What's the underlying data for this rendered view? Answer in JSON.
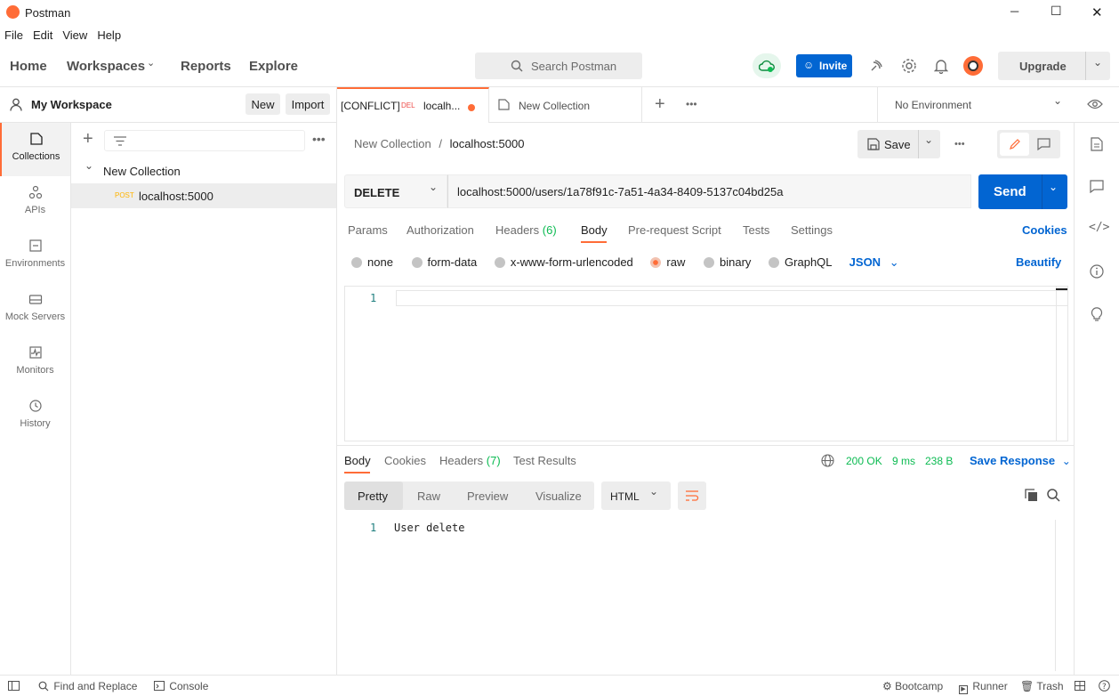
{
  "window": {
    "title": "Postman",
    "minimize": "─",
    "maximize": "☐",
    "close": "✕"
  },
  "menu": [
    "File",
    "Edit",
    "View",
    "Help"
  ],
  "header": {
    "home": "Home",
    "workspaces": "Workspaces",
    "reports": "Reports",
    "explore": "Explore",
    "search_placeholder": "Search Postman",
    "invite": "Invite",
    "upgrade": "Upgrade"
  },
  "sidebar": {
    "workspace_name": "My Workspace",
    "new_label": "New",
    "import_label": "Import",
    "rail": [
      {
        "label": "Collections",
        "icon": "collections-icon"
      },
      {
        "label": "APIs",
        "icon": "apis-icon"
      },
      {
        "label": "Environments",
        "icon": "environments-icon"
      },
      {
        "label": "Mock Servers",
        "icon": "mock-servers-icon"
      },
      {
        "label": "Monitors",
        "icon": "monitors-icon"
      },
      {
        "label": "History",
        "icon": "history-icon"
      }
    ],
    "collection_name": "New Collection",
    "request": {
      "method": "POST",
      "name": "localhost:5000"
    }
  },
  "tabs": [
    {
      "prefix": "[CONFLICT]",
      "method": "DEL",
      "name": "localh..."
    },
    {
      "name": "New Collection"
    }
  ],
  "environment": "No Environment",
  "breadcrumb": {
    "collection": "New Collection",
    "sep": "/",
    "request": "localhost:5000"
  },
  "save_label": "Save",
  "request": {
    "method": "DELETE",
    "url": "localhost:5000/users/1a78f91c-7a51-4a34-8409-5137c04bd25a",
    "send_label": "Send",
    "tabs": {
      "params": "Params",
      "auth": "Authorization",
      "headers": "Headers",
      "headers_count": "(6)",
      "body": "Body",
      "prereq": "Pre-request Script",
      "tests": "Tests",
      "settings": "Settings",
      "cookies": "Cookies"
    },
    "body_modes": {
      "none": "none",
      "form_data": "form-data",
      "urlencoded": "x-www-form-urlencoded",
      "raw": "raw",
      "binary": "binary",
      "graphql": "GraphQL",
      "format": "JSON",
      "beautify": "Beautify"
    },
    "editor_line": "1"
  },
  "response": {
    "tabs": {
      "body": "Body",
      "cookies": "Cookies",
      "headers": "Headers",
      "headers_count": "(7)",
      "tests": "Test Results"
    },
    "status": "200 OK",
    "time": "9 ms",
    "size": "238 B",
    "save_response": "Save Response",
    "views": {
      "pretty": "Pretty",
      "raw": "Raw",
      "preview": "Preview",
      "visualize": "Visualize",
      "format": "HTML"
    },
    "line": "1",
    "body": "User delete"
  },
  "statusbar": {
    "find": "Find and Replace",
    "console": "Console",
    "bootcamp": "Bootcamp",
    "runner": "Runner",
    "trash": "Trash"
  },
  "colors": {
    "accent": "#ff6c37",
    "primary": "#0265d2",
    "success": "#0cbb52"
  }
}
